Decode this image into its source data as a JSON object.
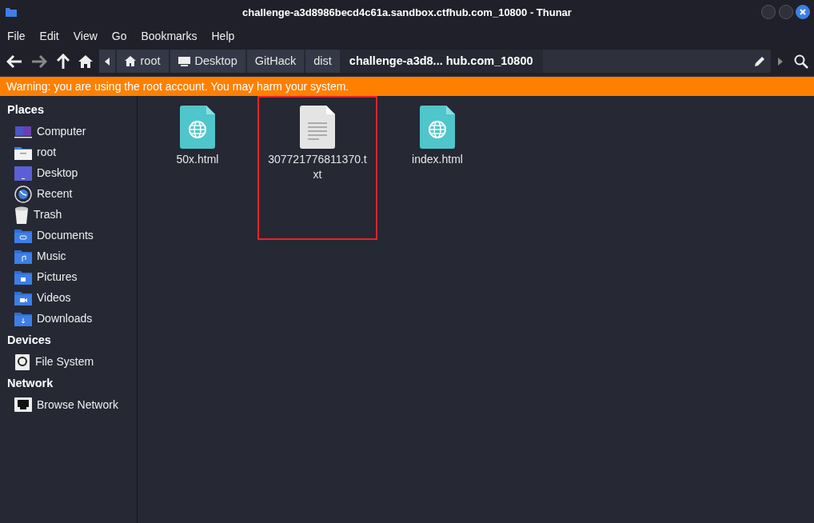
{
  "window": {
    "title": "challenge-a3d8986becd4c61a.sandbox.ctfhub.com_10800 - Thunar"
  },
  "menu": [
    "File",
    "Edit",
    "View",
    "Go",
    "Bookmarks",
    "Help"
  ],
  "path_bar": [
    {
      "label": "root",
      "selected": false
    },
    {
      "label": "Desktop",
      "selected": false
    },
    {
      "label": "GitHack",
      "selected": false
    },
    {
      "label": "dist",
      "selected": false
    },
    {
      "label": "challenge-a3d8... hub.com_10800",
      "selected": true
    }
  ],
  "warning": "Warning: you are using the root account. You may harm your system.",
  "sidebar": [
    {
      "heading": "Places",
      "items": [
        {
          "label": "Computer"
        },
        {
          "label": "root"
        },
        {
          "label": "Desktop"
        },
        {
          "label": "Recent"
        },
        {
          "label": "Trash"
        },
        {
          "label": "Documents"
        },
        {
          "label": "Music"
        },
        {
          "label": "Pictures"
        },
        {
          "label": "Videos"
        },
        {
          "label": "Downloads"
        }
      ]
    },
    {
      "heading": "Devices",
      "items": [
        {
          "label": "File System"
        }
      ]
    },
    {
      "heading": "Network",
      "items": [
        {
          "label": "Browse Network"
        }
      ]
    }
  ],
  "files": [
    {
      "name": "50x.html",
      "kind": "html",
      "highlighted": false
    },
    {
      "name": "307721776811370.txt",
      "kind": "text",
      "highlighted": true
    },
    {
      "name": "index.html",
      "kind": "html",
      "highlighted": false
    }
  ]
}
